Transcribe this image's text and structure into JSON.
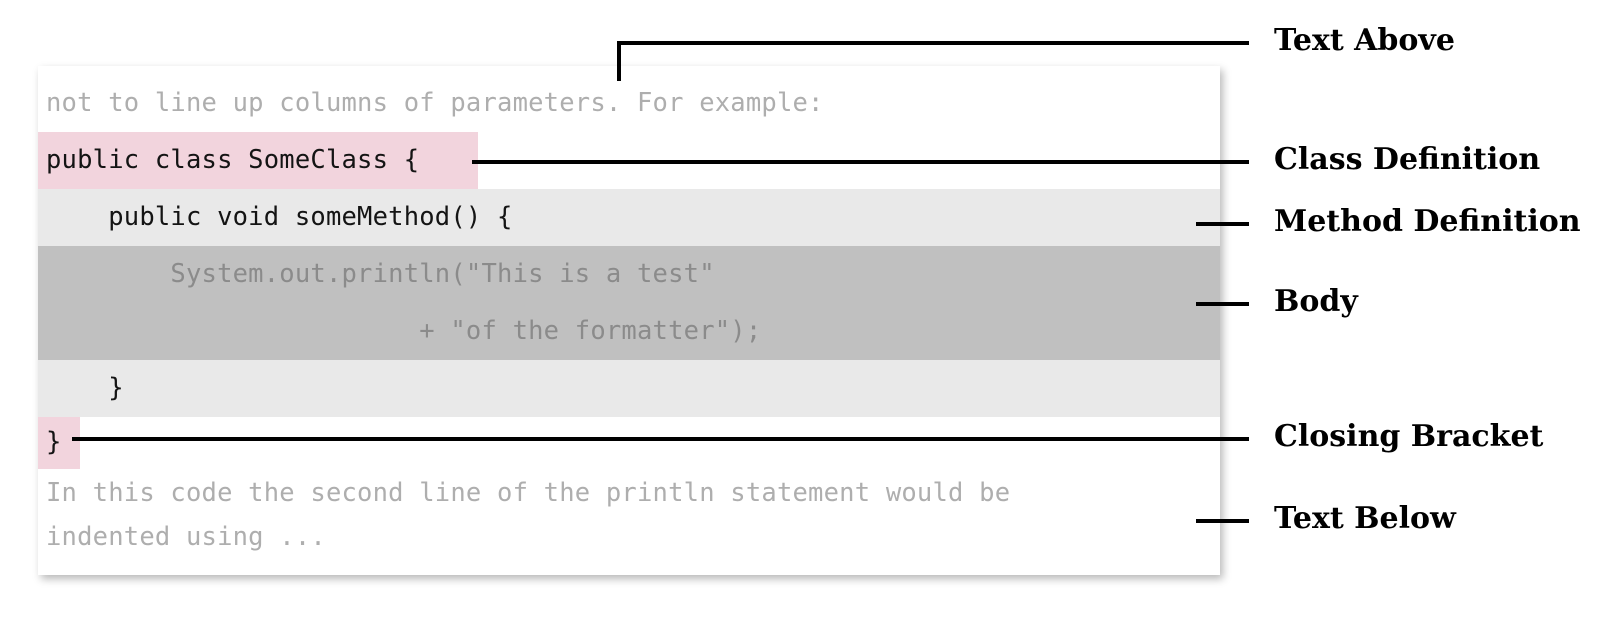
{
  "diagram": {
    "title": "Code block anatomy callout diagram",
    "colors": {
      "highlight_pink": "#f2d4dd",
      "highlight_light_gray": "#e9e9e9",
      "highlight_dark_gray": "#c0c0c0",
      "panel_background": "#ffffff",
      "leader_line": "#000000",
      "label_text": "#000000",
      "muted_code_text": "#aeaeae",
      "dim_code_text": "#8b8b8b",
      "dark_code_text": "#141414"
    }
  },
  "code_panel": {
    "lines": [
      {
        "id": "text-above",
        "text": "not to line up columns of parameters. For example:",
        "band": "white",
        "tone": "muted"
      },
      {
        "id": "class-def",
        "text": "public class SomeClass {",
        "band": "pink",
        "tone": "dark"
      },
      {
        "id": "method-def",
        "text": "    public void someMethod() {",
        "band": "light-gray",
        "tone": "dark"
      },
      {
        "id": "body-line-1",
        "text": "        System.out.println(\"This is a test\"",
        "band": "dark-gray",
        "tone": "dim"
      },
      {
        "id": "body-line-2",
        "text": "                        + \"of the formatter\");",
        "band": "dark-gray",
        "tone": "dim"
      },
      {
        "id": "method-close",
        "text": "    }",
        "band": "light-gray",
        "tone": "dark"
      },
      {
        "id": "closing-bracket",
        "text": "}",
        "band": "pink",
        "tone": "dark"
      },
      {
        "id": "text-below-1",
        "text": "In this code the second line of the println statement would be",
        "band": "white",
        "tone": "muted"
      },
      {
        "id": "text-below-2",
        "text": "indented using ...",
        "band": "white",
        "tone": "muted"
      }
    ]
  },
  "callouts": [
    {
      "id": "text-above",
      "label": "Text Above"
    },
    {
      "id": "class-definition",
      "label": "Class Definition"
    },
    {
      "id": "method-definition",
      "label": "Method Definition"
    },
    {
      "id": "body",
      "label": "Body"
    },
    {
      "id": "closing-bracket",
      "label": "Closing Bracket"
    },
    {
      "id": "text-below",
      "label": "Text Below"
    }
  ]
}
